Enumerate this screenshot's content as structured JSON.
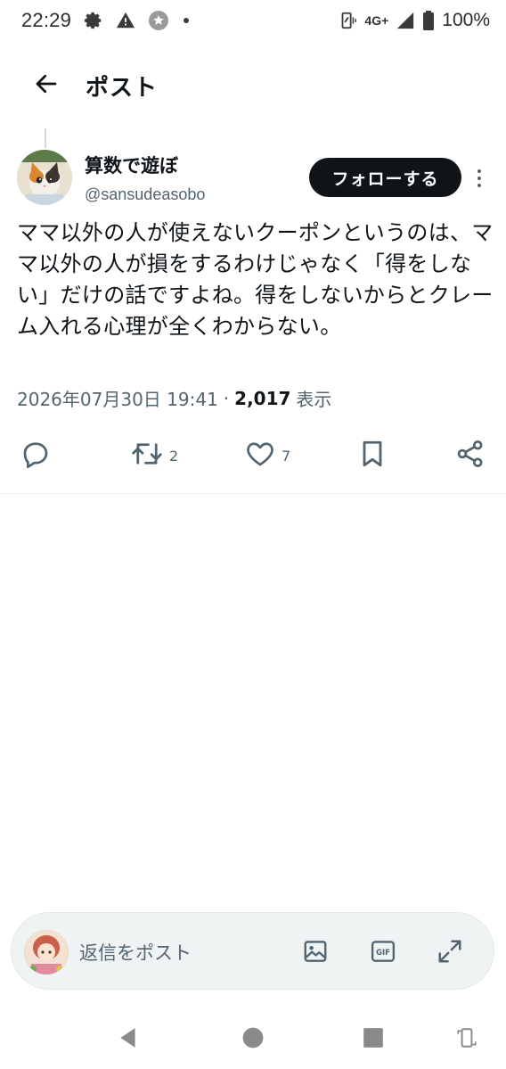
{
  "status_bar": {
    "time": "22:29",
    "network": "4G+",
    "battery": "100%",
    "icons": [
      "gear-icon",
      "warning-icon",
      "star-badge-icon",
      "dot-icon",
      "vibrate-icon",
      "signal-icon",
      "battery-icon"
    ]
  },
  "header": {
    "back_icon": "arrow-left-icon",
    "title": "ポスト"
  },
  "post": {
    "author": {
      "display_name": "算数で遊ぼ",
      "handle": "@sansudeasobo"
    },
    "follow_label": "フォローする",
    "text": "ママ以外の人が使えないクーポンというのは、ママ以外の人が損をするわけじゃなく「得をしない」だけの話ですよね。得をしないからとクレーム入れる心理が全くわからない。",
    "date": "2026年07月30日 19:41",
    "separator": "·",
    "views": "2,017",
    "views_label": "表示",
    "actions": {
      "reply_icon": "reply-icon",
      "retweet_icon": "retweet-icon",
      "retweet_count": "2",
      "like_icon": "heart-icon",
      "like_count": "7",
      "bookmark_icon": "bookmark-icon",
      "share_icon": "share-icon"
    }
  },
  "reply_bar": {
    "placeholder": "返信をポスト",
    "icons": [
      "image-icon",
      "gif-icon",
      "expand-icon"
    ],
    "gif_label": "GIF"
  },
  "nav_bar": {
    "icons": [
      "nav-back-icon",
      "nav-home-icon",
      "nav-recents-icon",
      "rotate-icon"
    ]
  },
  "colors": {
    "text_primary": "#0f1419",
    "text_secondary": "#536471",
    "follow_bg": "#0f1419",
    "reply_bar_bg": "#eff3f4"
  }
}
